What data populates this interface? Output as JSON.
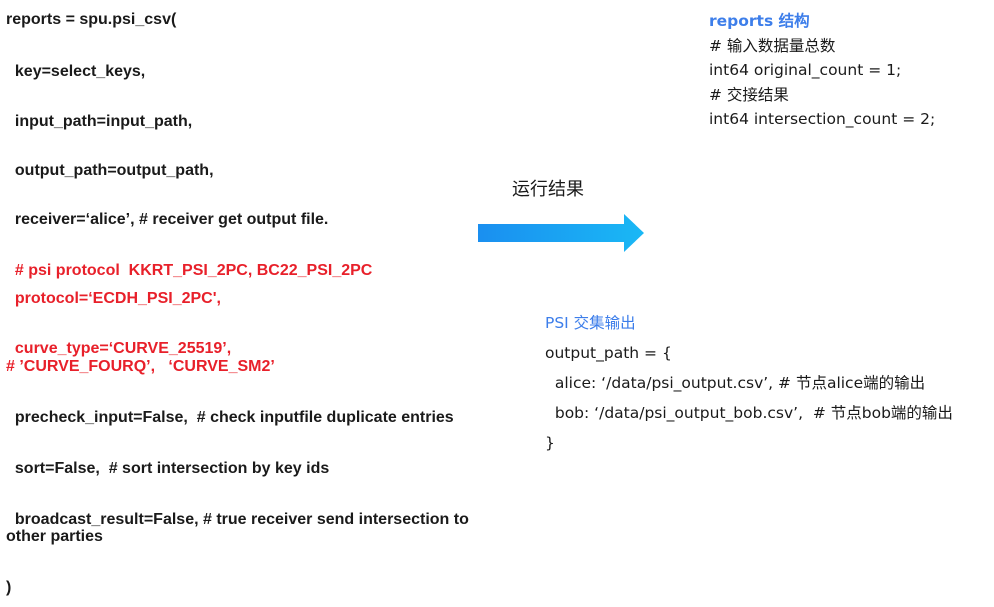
{
  "code": {
    "open": "reports = spu.psi_csv(",
    "key": "  key=select_keys,",
    "input_path": "  input_path=input_path,",
    "output_path": "  output_path=output_path,",
    "receiver": "  receiver=‘alice’, # receiver get output file.",
    "protocol_comment": "  # psi protocol  KKRT_PSI_2PC, BC22_PSI_2PC",
    "protocol": "  protocol=‘ECDH_PSI_2PC',",
    "curve_type": "  curve_type=‘CURVE_25519’,",
    "curve_comment": "# ’CURVE_FOURQ’,   ‘CURVE_SM2’",
    "precheck": "  precheck_input=False,  # check inputfile duplicate entries",
    "sort": "  sort=False,  # sort intersection by key ids",
    "broadcast": "  broadcast_result=False, # true receiver send intersection to",
    "broadcast_cont": "other parties",
    "close": ")"
  },
  "arrow": {
    "caption": "运行结果",
    "color_start": "#1a8ff0",
    "color_end": "#1ab8f5"
  },
  "reports": {
    "title": "reports 结构",
    "lines": [
      "# 输入数据量总数",
      "int64 original_count = 1;",
      "# 交接结果",
      "int64 intersection_count = 2;"
    ]
  },
  "psi_output": {
    "title": "PSI 交集输出",
    "lines": [
      "output_path = {",
      "  alice: ‘/data/psi_output.csv’, # 节点alice端的输出",
      "  bob: ‘/data/psi_output_bob.csv’,  # 节点bob端的输出",
      "}"
    ]
  },
  "colors": {
    "code_text": "#1a1a1a",
    "code_highlight": "#e8202a",
    "title_blue": "#3d7eea"
  }
}
